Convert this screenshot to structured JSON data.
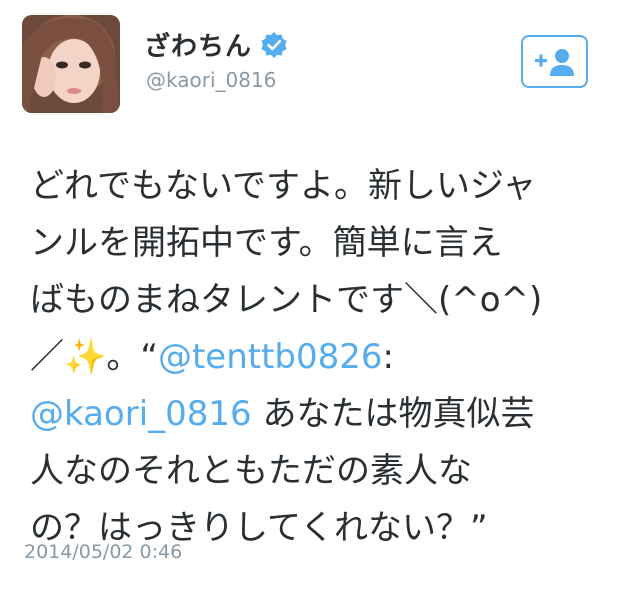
{
  "user": {
    "display_name": "ざわちん",
    "screen_name": "@kaori_0816",
    "verified": true
  },
  "follow_button": {
    "icon": "add-user-icon",
    "color": "#55acee"
  },
  "tweet": {
    "line1": "どれでもないですよ。新しいジャ",
    "line2": "ンルを開拓中です。簡単に言え",
    "line3": "ばものまねタレントです＼(^o^)",
    "line4_prefix": "／✨。“",
    "line4_mention": "@tenttb0826",
    "line4_suffix": ":",
    "line5_mention": "@kaori_0816",
    "line5_text": " あなたは物真似芸",
    "line6": "人なのそれともただの素人な",
    "line7": "の？はっきりしてくれない？”"
  },
  "timestamp": "2014/05/02 0:46",
  "colors": {
    "link": "#55acee",
    "text": "#292f33",
    "meta": "#8899a6"
  }
}
